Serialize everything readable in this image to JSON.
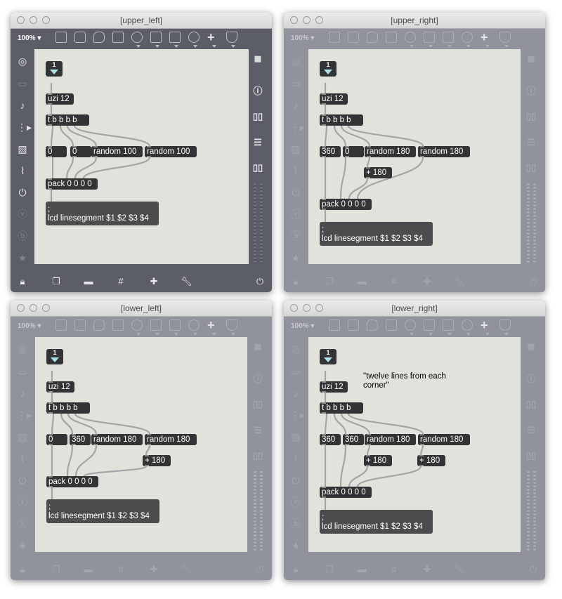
{
  "windows": {
    "upper_left": {
      "title": "[upper_left]",
      "zoom": "100%",
      "inlet_number": "1",
      "objects": {
        "uzi": "uzi 12",
        "trigger": "t b b b b",
        "num_a": "0",
        "num_b": "0",
        "rand_a": "random 100",
        "rand_b": "random 100",
        "pack": "pack 0 0 0 0"
      },
      "message": ";\nlcd linesegment $1 $2 $3 $4"
    },
    "upper_right": {
      "title": "[upper_right]",
      "zoom": "100%",
      "inlet_number": "1",
      "objects": {
        "uzi": "uzi 12",
        "trigger": "t b b b b",
        "num_a": "360",
        "num_b": "0",
        "rand_a": "random 180",
        "rand_b": "random 180",
        "plus_a": "+ 180",
        "pack": "pack 0 0 0 0"
      },
      "message": ";\nlcd linesegment $1 $2 $3 $4"
    },
    "lower_left": {
      "title": "[lower_left]",
      "zoom": "100%",
      "inlet_number": "1",
      "objects": {
        "uzi": "uzi 12",
        "trigger": "t b b b b",
        "num_a": "0",
        "num_b": "360",
        "rand_a": "random 180",
        "rand_b": "random 180",
        "plus_b": "+ 180",
        "pack": "pack 0 0 0 0"
      },
      "message": ";\nlcd linesegment $1 $2 $3 $4"
    },
    "lower_right": {
      "title": "[lower_right]",
      "zoom": "100%",
      "inlet_number": "1",
      "comment": "\"twelve lines from each\ncorner\"",
      "objects": {
        "uzi": "uzi 12",
        "trigger": "t b b b b",
        "num_a": "360",
        "num_b": "360",
        "rand_a": "random 180",
        "rand_b": "random 180",
        "plus_a": "+ 180",
        "plus_b": "+ 180",
        "pack": "pack 0 0 0 0"
      },
      "message": ";\nlcd linesegment $1 $2 $3 $4"
    }
  },
  "icons": {
    "toolbar": [
      "presentation-icon",
      "bpatcher-icon",
      "comment-icon",
      "message-icon",
      "button-icon",
      "toggle-icon",
      "play-icon",
      "slider-icon",
      "dial-icon",
      "add-icon",
      "paint-bucket-icon"
    ],
    "left_sidebar": [
      "target-icon",
      "window-icon",
      "music-note-icon",
      "media-icon",
      "image-icon",
      "paperclip-icon",
      "plug-icon",
      "v-icon",
      "b-icon",
      "star-icon"
    ],
    "right_sidebar": [
      "grid-icon",
      "info-icon",
      "book-icon",
      "list-icon",
      "reference-icon"
    ],
    "bottom": [
      "lock-icon",
      "windows-icon",
      "presentation-mode-icon",
      "grid-toggle-icon",
      "add-object-icon",
      "wrench-icon",
      "power-icon"
    ]
  },
  "colors": {
    "active_chrome": "#5b5e66",
    "inactive_chrome": "#90939b",
    "canvas": "#e2e2dd",
    "object": "#333435",
    "cord": "#a3a5a7",
    "inlet_triangle": "#a9e0e1"
  }
}
